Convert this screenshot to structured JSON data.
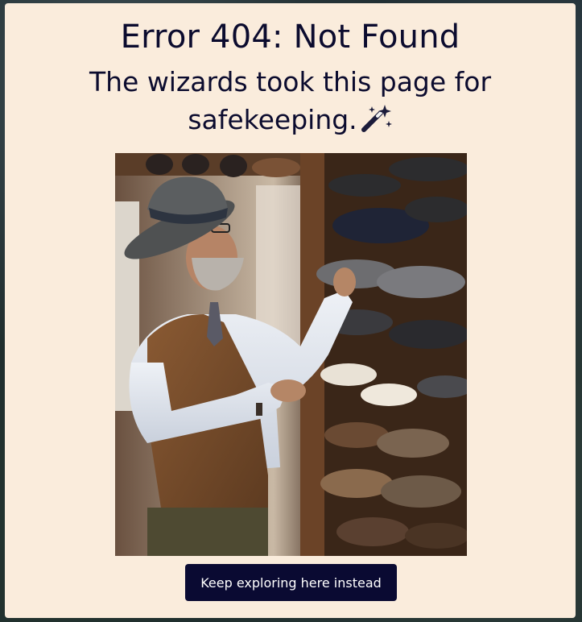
{
  "page": {
    "heading": "Error 404: Not Found",
    "message": "The wizards took this page for safekeeping.",
    "message_icon": "magic-wand-icon"
  },
  "image": {
    "description": "man in hat and vest examining hats on a shop shelf"
  },
  "actions": {
    "keep_exploring_label": "Keep exploring here instead"
  },
  "colors": {
    "card_background": "#faecdc",
    "text": "#0b0b2e",
    "button_background": "#0a0a32",
    "button_text": "#ffffff"
  }
}
